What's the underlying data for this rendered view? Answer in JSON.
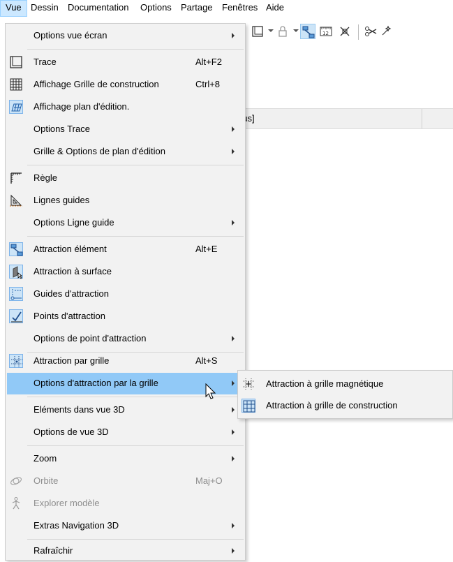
{
  "menubar": {
    "items": [
      {
        "label": "Vue",
        "active": true
      },
      {
        "label": "Dessin"
      },
      {
        "label": "Documentation"
      },
      {
        "label": "Options"
      },
      {
        "label": "Partage"
      },
      {
        "label": "Fenêtres"
      },
      {
        "label": "Aide"
      }
    ]
  },
  "background": {
    "panel_text": "ous]"
  },
  "menu": {
    "items": [
      {
        "label": "Options vue écran",
        "submenu": true
      },
      {
        "label": "Trace",
        "shortcut": "Alt+F2",
        "icon": "trace-icon"
      },
      {
        "label": "Affichage Grille de construction",
        "shortcut": "Ctrl+8",
        "icon": "construction-grid-icon"
      },
      {
        "label": "Affichage plan d'édition.",
        "icon": "editing-plane-icon",
        "checked": true
      },
      {
        "label": "Options Trace",
        "submenu": true
      },
      {
        "label": "Grille & Options de plan d'édition",
        "submenu": true
      },
      {
        "label": "Règle",
        "icon": "ruler-icon"
      },
      {
        "label": "Lignes guides",
        "icon": "guide-lines-icon"
      },
      {
        "label": "Options Ligne guide",
        "submenu": true
      },
      {
        "label": "Attraction élément",
        "shortcut": "Alt+E",
        "icon": "element-snap-icon",
        "checked": true
      },
      {
        "label": "Attraction à surface",
        "icon": "surface-snap-icon",
        "checked": true
      },
      {
        "label": "Guides d'attraction",
        "icon": "snap-guides-icon",
        "checked": true
      },
      {
        "label": "Points d'attraction",
        "icon": "snap-points-icon",
        "checked": true
      },
      {
        "label": "Options de point d'attraction",
        "submenu": true
      },
      {
        "label": "Attraction par grille",
        "shortcut": "Alt+S",
        "icon": "grid-snap-icon",
        "checked": true
      },
      {
        "label": "Options d'attraction par la grille",
        "submenu": true,
        "highlighted": true
      },
      {
        "label": "Eléments dans vue 3D",
        "submenu": true
      },
      {
        "label": "Options de vue 3D",
        "submenu": true
      },
      {
        "label": "Zoom",
        "submenu": true
      },
      {
        "label": "Orbite",
        "shortcut": "Maj+O",
        "icon": "orbit-icon",
        "disabled": true
      },
      {
        "label": "Explorer modèle",
        "icon": "explorer-walk-icon",
        "disabled": true
      },
      {
        "label": "Extras Navigation 3D",
        "submenu": true
      },
      {
        "label": "Rafraîchir",
        "submenu": true
      }
    ]
  },
  "submenu": {
    "items": [
      {
        "label": "Attraction à grille magnétique",
        "icon": "magnetic-grid-icon"
      },
      {
        "label": "Attraction à grille de construction",
        "icon": "construction-grid-snap-icon",
        "checked": true
      }
    ]
  },
  "colors": {
    "menu_bg": "#f2f2f2",
    "highlight": "#91c9f7",
    "check_bg": "#cce4f7",
    "disabled_text": "#8d8d8d"
  }
}
